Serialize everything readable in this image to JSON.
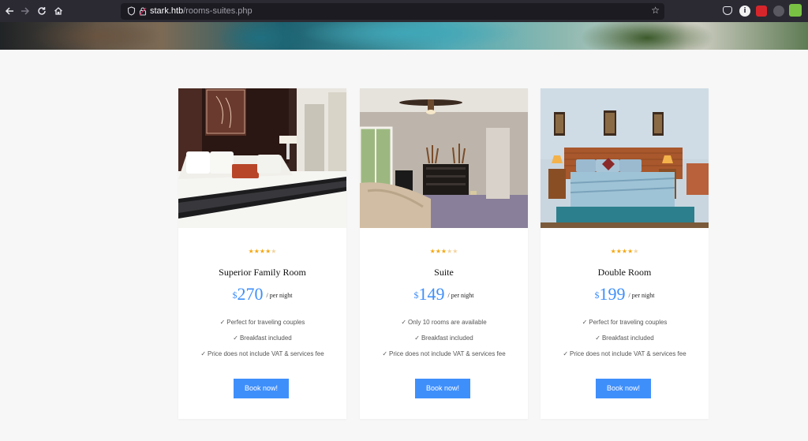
{
  "browser": {
    "url_host": "stark.htb",
    "url_path": "/rooms-suites.php",
    "icons": {
      "back": "arrow-left-icon",
      "forward": "arrow-right-icon",
      "reload": "reload-icon",
      "home": "home-icon",
      "shield": "shield-icon",
      "lock": "lock-icon",
      "bookmark": "star-icon"
    }
  },
  "accent_color": "#3f8ffb",
  "star_color": "#f4a814",
  "rooms": [
    {
      "rating": 4,
      "rating_max": 5,
      "title": "Superior Family Room",
      "currency": "$",
      "price": "270",
      "per": "/ per night",
      "features": [
        "Perfect for traveling couples",
        "Breakfast included",
        "Price does not include VAT & services fee"
      ],
      "button": "Book now!"
    },
    {
      "rating": 3,
      "rating_max": 5,
      "title": "Suite",
      "currency": "$",
      "price": "149",
      "per": "/ per night",
      "features": [
        "Only 10 rooms are available",
        "Breakfast included",
        "Price does not include VAT & services fee"
      ],
      "button": "Book now!"
    },
    {
      "rating": 4,
      "rating_max": 5,
      "title": "Double Room",
      "currency": "$",
      "price": "199",
      "per": "/ per night",
      "features": [
        "Perfect for traveling couples",
        "Breakfast included",
        "Price does not include VAT & services fee"
      ],
      "button": "Book now!"
    }
  ]
}
